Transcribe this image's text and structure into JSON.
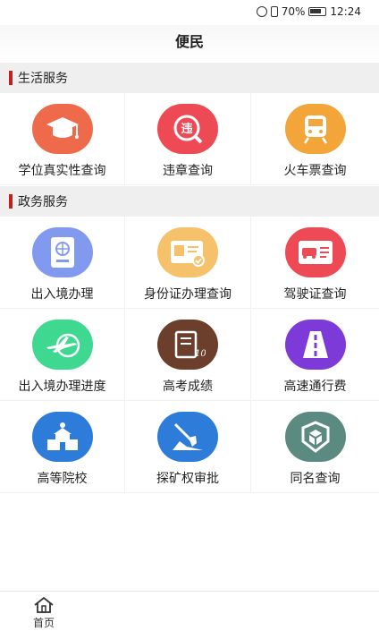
{
  "status_bar": {
    "battery": "70%",
    "time": "12:24"
  },
  "header": {
    "title": "便民"
  },
  "sections": [
    {
      "title": "生活服务",
      "items": [
        {
          "label": "学位真实性查询",
          "icon": "graduation-cap-icon",
          "color": "#ef6a4a"
        },
        {
          "label": "违章查询",
          "icon": "traffic-violation-icon",
          "color": "#ee4a56"
        },
        {
          "label": "火车票查询",
          "icon": "train-icon",
          "color": "#f3a53a"
        }
      ]
    },
    {
      "title": "政务服务",
      "items": [
        {
          "label": "出入境办理",
          "icon": "passport-icon",
          "color": "#8199ef"
        },
        {
          "label": "身份证办理查询",
          "icon": "id-card-icon",
          "color": "#f6c16b"
        },
        {
          "label": "驾驶证查询",
          "icon": "driver-license-icon",
          "color": "#ee4a56"
        },
        {
          "label": "出入境办理进度",
          "icon": "airplane-icon",
          "color": "#3fd890"
        },
        {
          "label": "高考成绩",
          "icon": "exam-score-icon",
          "color": "#6b3f2b"
        },
        {
          "label": "高速通行费",
          "icon": "highway-icon",
          "color": "#7d3ad8"
        },
        {
          "label": "高等院校",
          "icon": "university-icon",
          "color": "#2e7cd9"
        },
        {
          "label": "探矿权审批",
          "icon": "mining-icon",
          "color": "#2e7cd9"
        },
        {
          "label": "同名查询",
          "icon": "shield-cube-icon",
          "color": "#5a8a80"
        }
      ]
    }
  ],
  "bottom_nav": {
    "home_label": "首页",
    "home_icon": "home-icon"
  }
}
